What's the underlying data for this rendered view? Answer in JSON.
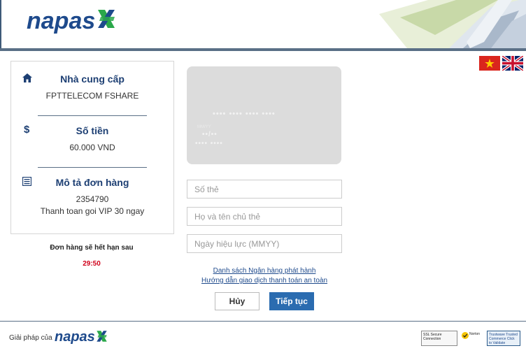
{
  "header": {
    "logo_text": "napas"
  },
  "language": {
    "vietnamese_flag": "vn-flag-icon",
    "english_flag": "uk-flag-icon"
  },
  "order": {
    "provider_title": "Nhà cung cấp",
    "provider_value": "FPTTELECOM FSHARE",
    "amount_title": "Số tiền",
    "amount_value": "60.000 VND",
    "description_title": "Mô tả đơn hàng",
    "order_id": "2354790",
    "description_value": "Thanh toan goi VIP 30 ngay",
    "expire_label": "Đơn hàng sẽ hết hạn sau",
    "expire_time": "29:50"
  },
  "card_preview": {
    "number_mask": "•••• •••• •••• ••••",
    "expiry_label": "MM/YY",
    "expiry_mask": "••/••",
    "name_mask": "•••• ••••"
  },
  "form": {
    "card_number_placeholder": "Số thẻ",
    "card_holder_placeholder": "Họ và tên chủ thẻ",
    "issue_date_placeholder": "Ngày hiệu lực (MMYY)"
  },
  "links": {
    "bank_list": "Danh sách Ngân hàng phát hành",
    "safe_guide": "Hướng dẫn giao dịch thanh toán an toàn"
  },
  "buttons": {
    "cancel": "Hủy",
    "next": "Tiếp tục"
  },
  "footer": {
    "solution_text": "Giải pháp của",
    "logo_text": "napas",
    "ssl_badge": "SSL Secure Connection",
    "norton_badge": "Norton",
    "trustwave_badge": "Trustwave Trusted Commerce Click to Validate"
  },
  "colors": {
    "brand_blue": "#1e4a8c",
    "brand_green": "#2aa84a",
    "button_blue": "#2b6cb0",
    "expire_red": "#d0021b"
  }
}
